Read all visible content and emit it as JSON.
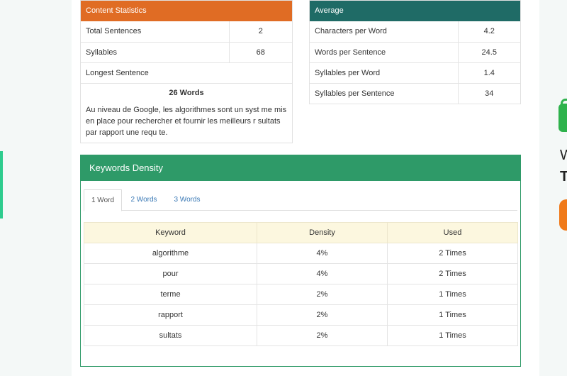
{
  "content_statistics": {
    "title": "Content Statistics",
    "rows": [
      {
        "label": "Total Sentences",
        "value": "2"
      },
      {
        "label": "Syllables",
        "value": "68"
      }
    ],
    "longest_label": "Longest Sentence",
    "longest_words": "26 Words",
    "longest_text": "Au niveau de Google, les algorithmes sont un syst me mis en place pour rechercher et fournir les meilleurs r sultats par rapport une requ te."
  },
  "average": {
    "title": "Average",
    "rows": [
      {
        "label": "Characters per Word",
        "value": "4.2"
      },
      {
        "label": "Words per Sentence",
        "value": "24.5"
      },
      {
        "label": "Syllables per Word",
        "value": "1.4"
      },
      {
        "label": "Syllables per Sentence",
        "value": "34"
      }
    ]
  },
  "keywords_density": {
    "title": "Keywords Density",
    "tabs": [
      "1 Word",
      "2 Words",
      "3 Words"
    ],
    "active_tab": "1 Word",
    "columns": [
      "Keyword",
      "Density",
      "Used"
    ],
    "rows": [
      [
        "algorithme",
        "4%",
        "2 Times"
      ],
      [
        "pour",
        "4%",
        "2 Times"
      ],
      [
        "terme",
        "2%",
        "1 Times"
      ],
      [
        "rapport",
        "2%",
        "1 Times"
      ],
      [
        "sultats",
        "2%",
        "1 Times"
      ]
    ]
  },
  "side_ad": {
    "letter_1": "W",
    "letter_2": "T",
    "lock_icon": "lock-icon",
    "colors": {
      "lock": "#2eb24c",
      "button": "#f07a1a"
    }
  },
  "colors": {
    "stats_header": "#e06c24",
    "average_header": "#1f6b66",
    "keywords_header": "#2e9a68",
    "table_header_bg": "#fcf7df",
    "tab_link": "#3a79b5"
  }
}
